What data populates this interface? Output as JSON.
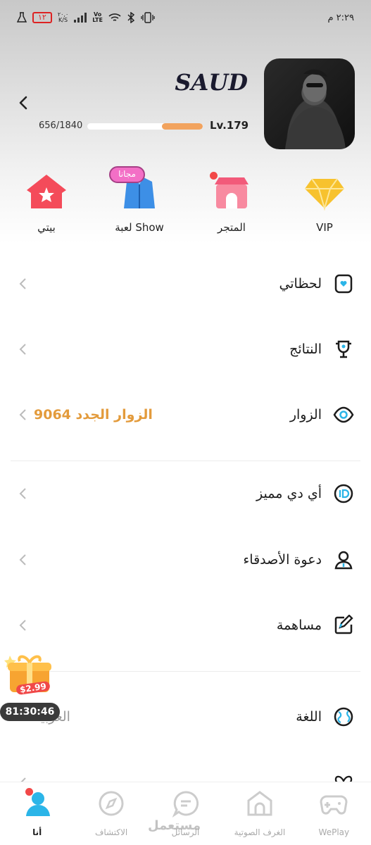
{
  "status_bar": {
    "time": "٢:٢٩ م",
    "battery": "١٢",
    "speed_value": "٢٠,٠",
    "speed_unit": "K/S",
    "network_top": "Vo",
    "network_bottom": "LTE"
  },
  "profile": {
    "username": "SAUD",
    "xp_text": "656/1840",
    "xp_fraction": 0.3565,
    "level": "Lv.179"
  },
  "quick_actions": [
    {
      "label": "VIP",
      "icon": "diamond-icon"
    },
    {
      "label": "المتجر",
      "icon": "store-icon"
    },
    {
      "label": "لعبة Show",
      "icon": "show-game-icon",
      "badge": "مجانا"
    },
    {
      "label": "بيتي",
      "icon": "home-icon"
    }
  ],
  "menu": {
    "moments": "لحظاتي",
    "results": "النتائج",
    "visitors": "الزوار",
    "new_visitors": "9064 الزوار الجدد",
    "special_id": "أي دي مميز",
    "invite_friends": "دعوة الأصدقاء",
    "contribution": "مساهمة",
    "language": "اللغة",
    "language_value": "العربية"
  },
  "promo": {
    "price": "$2.99",
    "timer": "81:30:46"
  },
  "tabs": [
    {
      "label": "أنا",
      "icon": "me-icon",
      "active": true
    },
    {
      "label": "الاكتشاف",
      "icon": "compass-icon"
    },
    {
      "label": "الرسائل",
      "icon": "chat-icon"
    },
    {
      "label": "الغرف الصوتية",
      "icon": "voice-room-icon"
    },
    {
      "label": "WePlay",
      "icon": "gamepad-icon"
    }
  ],
  "watermark": "مستعمل",
  "colors": {
    "accent_orange": "#e39b3c",
    "xp_fill": "#f2a35e",
    "badge_pink": "#f36fc6",
    "active_tab": "#2bb5e8"
  }
}
